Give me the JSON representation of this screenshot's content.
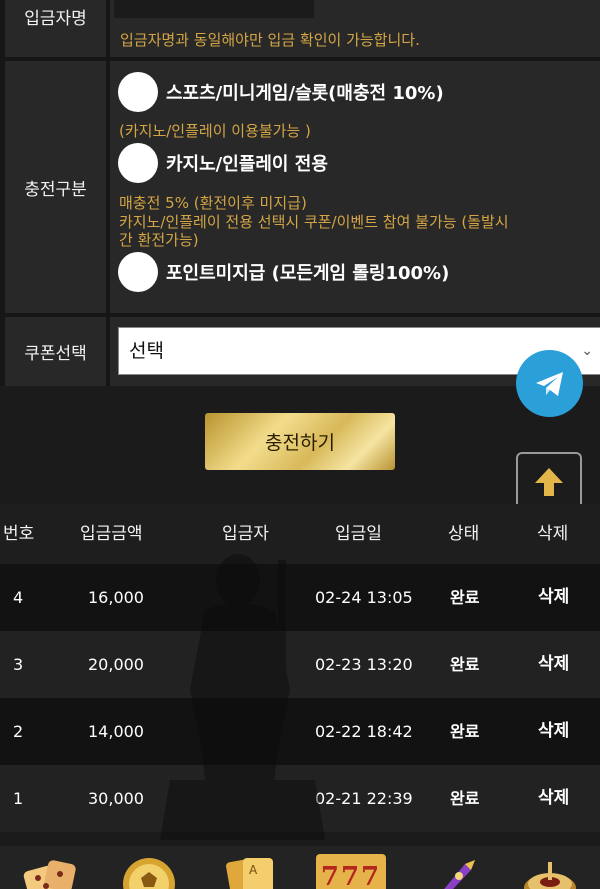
{
  "form": {
    "depositor_label": "입금자명",
    "depositor_notice": "입금자명과 동일해야만 입금 확인이 가능합니다.",
    "charge_type_label": "충전구분",
    "options": [
      {
        "label": "스포츠/미니게임/슬롯(매충전 10%)",
        "note": "(카지노/인플레이 이용불가능 )"
      },
      {
        "label": "카지노/인플레이 전용",
        "note_lines": [
          "매충전 5% (환전이후 미지급)",
          "카지노/인플레이 전용 선택시 쿠폰/이벤트 참여 불가능 (돌발시",
          "간 환전가능)"
        ]
      },
      {
        "label": "포인트미지급 (모든게임 롤링100%)"
      }
    ],
    "coupon_label": "쿠폰선택",
    "coupon_selected": "선택"
  },
  "charge_button": "충전하기",
  "table": {
    "headers": [
      "번호",
      "입금금액",
      "입금자",
      "입금일",
      "상태",
      "삭제"
    ],
    "rows": [
      {
        "no": "4",
        "amount": "16,000",
        "depositor": "",
        "date": "02-24 13:05",
        "status": "완료",
        "action": "삭제"
      },
      {
        "no": "3",
        "amount": "20,000",
        "depositor": "",
        "date": "02-23 13:20",
        "status": "완료",
        "action": "삭제"
      },
      {
        "no": "2",
        "amount": "14,000",
        "depositor": "",
        "date": "02-22 18:42",
        "status": "완료",
        "action": "삭제"
      },
      {
        "no": "1",
        "amount": "30,000",
        "depositor": "",
        "date": "02-21 22:39",
        "status": "완료",
        "action": "삭제"
      }
    ]
  },
  "bottom_nav": {
    "icons": [
      "dice-icon",
      "soccer-ball-icon",
      "playing-cards-icon",
      "slot-777-icon",
      "rocket-icon",
      "roulette-icon"
    ],
    "slot_text": "777"
  },
  "colors": {
    "accent_gold": "#d3a545",
    "telegram_blue": "#2a9fd8"
  }
}
